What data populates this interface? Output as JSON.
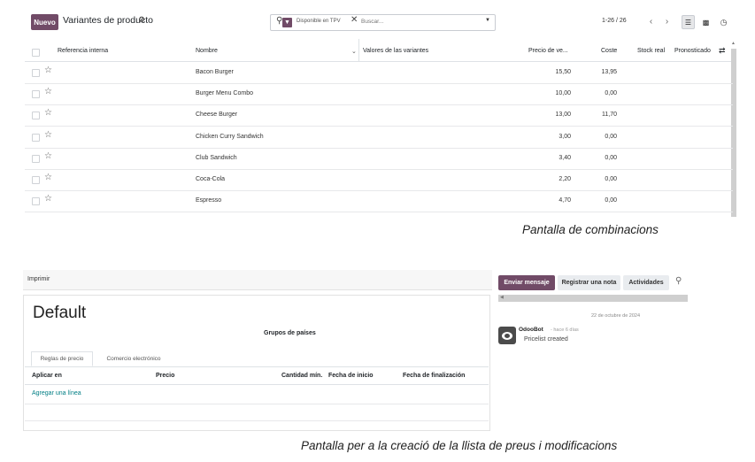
{
  "top": {
    "new_button": "Nuevo",
    "title": "Variantes de producto",
    "search": {
      "facet_label": "Disponible en TPV",
      "placeholder": "Buscar..."
    },
    "pager": "1-26 / 26",
    "columns": [
      "Referencia interna",
      "Nombre",
      "Valores de las variantes",
      "Precio de ve...",
      "Coste",
      "Stock real",
      "Pronosticado"
    ],
    "rows": [
      {
        "name": "Bacon Burger",
        "price": "15,50",
        "cost": "13,95"
      },
      {
        "name": "Burger Menu Combo",
        "price": "10,00",
        "cost": "0,00"
      },
      {
        "name": "Cheese Burger",
        "price": "13,00",
        "cost": "11,70"
      },
      {
        "name": "Chicken Curry Sandwich",
        "price": "3,00",
        "cost": "0,00"
      },
      {
        "name": "Club Sandwich",
        "price": "3,40",
        "cost": "0,00"
      },
      {
        "name": "Coca-Cola",
        "price": "2,20",
        "cost": "0,00"
      },
      {
        "name": "Espresso",
        "price": "4,70",
        "cost": "0,00"
      }
    ],
    "caption": "Pantalla de combinacions"
  },
  "bottom": {
    "print_button": "Imprimir",
    "pricelist_name": "Default",
    "group_label": "Grupos de países",
    "tabs": [
      "Reglas de precio",
      "Comercio electrónico"
    ],
    "columns": [
      "Aplicar en",
      "Precio",
      "Cantidad mín.",
      "Fecha de inicio",
      "Fecha de finalización"
    ],
    "add_line": "Agregar una línea",
    "chatter": {
      "send_message": "Enviar mensaje",
      "log_note": "Registrar una nota",
      "activities": "Actividades",
      "date": "22 de octubre de 2024",
      "author": "OdooBot",
      "time": "- hace 6 días",
      "message": "Pricelist created"
    },
    "caption": "Pantalla per a la creació de la llista de preus i modificacions"
  },
  "colors": {
    "brand": "#714b67",
    "link": "#017e84"
  },
  "icons": [
    "gear-icon",
    "search-icon",
    "filter-icon",
    "star-icon",
    "list-view-icon",
    "kanban-view-icon",
    "activity-view-icon",
    "avatar-icon"
  ]
}
